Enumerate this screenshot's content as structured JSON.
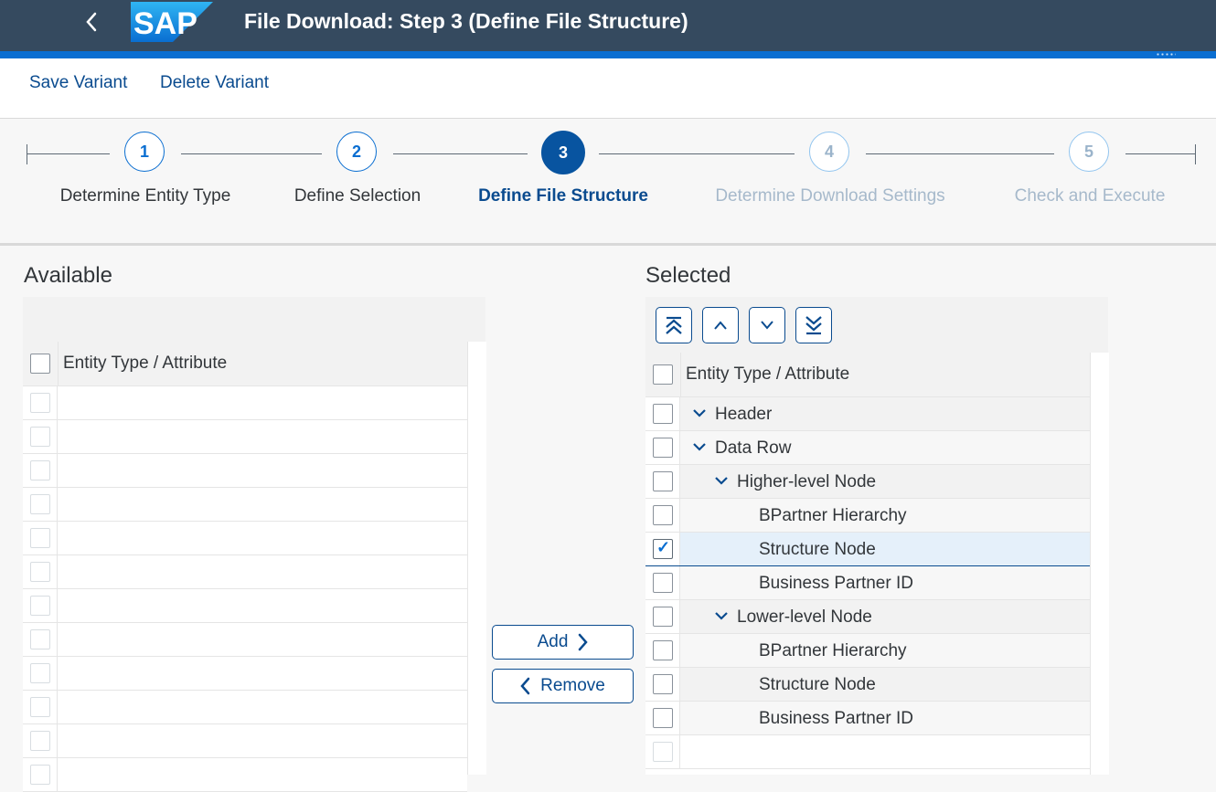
{
  "shell": {
    "logo_text": "SAP",
    "title": "File Download: Step 3 (Define File Structure)"
  },
  "toolbar": {
    "save_variant": "Save Variant",
    "delete_variant": "Delete Variant"
  },
  "wizard": {
    "current_step": 3,
    "steps": [
      {
        "number": "1",
        "label": "Determine Entity Type",
        "state": "completed"
      },
      {
        "number": "2",
        "label": "Define Selection",
        "state": "completed"
      },
      {
        "number": "3",
        "label": "Define File Structure",
        "state": "active"
      },
      {
        "number": "4",
        "label": "Determine Download Settings",
        "state": "disabled"
      },
      {
        "number": "5",
        "label": "Check and Execute",
        "state": "disabled"
      }
    ]
  },
  "available": {
    "heading": "Available",
    "column_header": "Entity Type / Attribute",
    "rows": []
  },
  "actions": {
    "add": "Add",
    "remove": "Remove"
  },
  "selected": {
    "heading": "Selected",
    "column_header": "Entity Type / Attribute",
    "toolbar_icons": [
      "move-to-top-icon",
      "move-up-icon",
      "move-down-icon",
      "move-to-bottom-icon"
    ],
    "rows": [
      {
        "label": "Header",
        "level": 0,
        "expandable": true,
        "checked": false
      },
      {
        "label": "Data Row",
        "level": 0,
        "expandable": true,
        "checked": false
      },
      {
        "label": "Higher-level Node",
        "level": 1,
        "expandable": true,
        "checked": false
      },
      {
        "label": "BPartner Hierarchy",
        "level": 2,
        "expandable": false,
        "checked": false
      },
      {
        "label": "Structure Node",
        "level": 2,
        "expandable": false,
        "checked": true
      },
      {
        "label": "Business Partner ID",
        "level": 2,
        "expandable": false,
        "checked": false
      },
      {
        "label": "Lower-level Node",
        "level": 1,
        "expandable": true,
        "checked": false
      },
      {
        "label": "BPartner Hierarchy",
        "level": 2,
        "expandable": false,
        "checked": false
      },
      {
        "label": "Structure Node",
        "level": 2,
        "expandable": false,
        "checked": false
      },
      {
        "label": "Business Partner ID",
        "level": 2,
        "expandable": false,
        "checked": false
      }
    ]
  },
  "colors": {
    "shell_bg": "#354a5f",
    "accent": "#0a6ed1",
    "link": "#0a4b8f",
    "active_step": "#0854a0",
    "selected_row": "#e5f0fa"
  }
}
